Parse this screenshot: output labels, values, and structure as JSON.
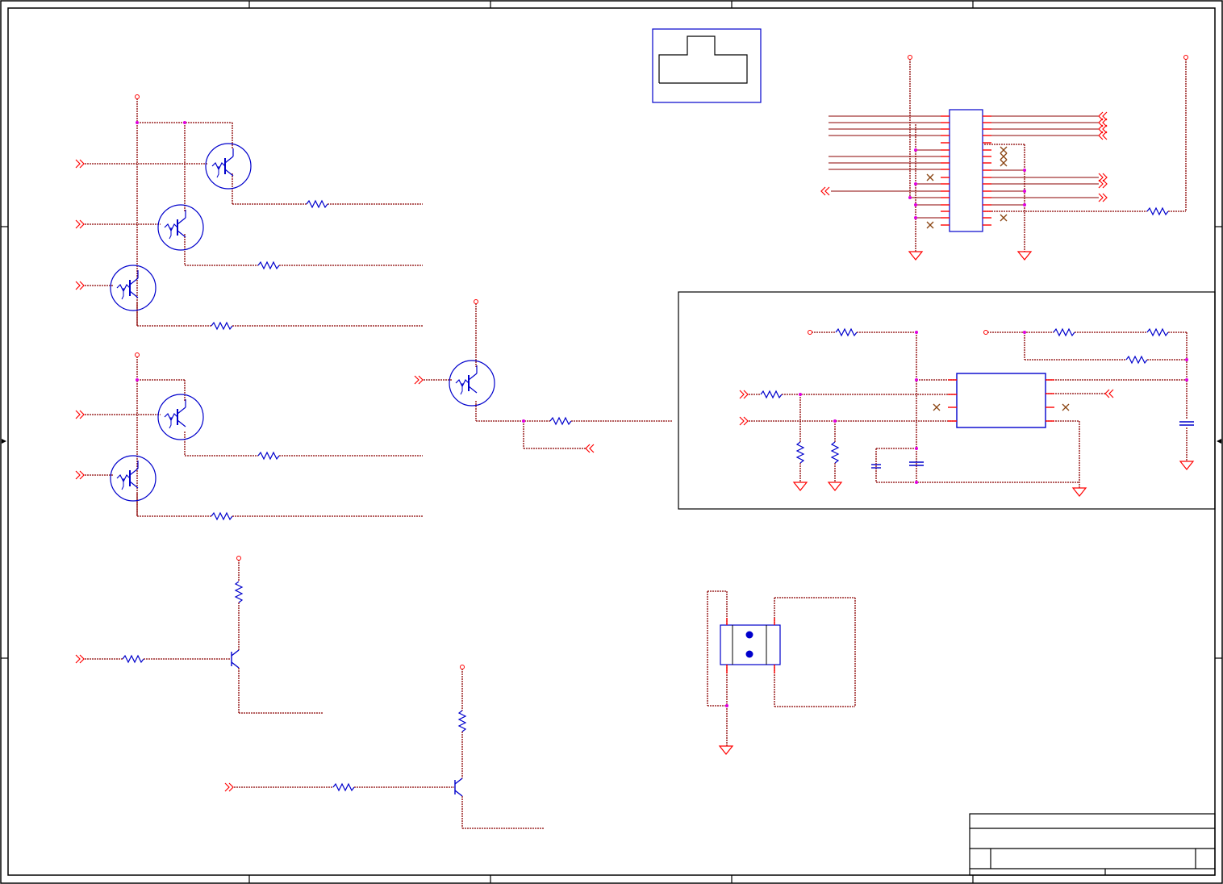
{
  "document": {
    "type": "schematic-sheet",
    "texts": []
  },
  "colors": {
    "wire": "#8b0000",
    "wire_dots": "#d06080",
    "pin": "#ff0000",
    "component": "#0000cc",
    "junction": "#e000e0",
    "no_connect": "#8b4513",
    "border": "#000000"
  },
  "title_block": {
    "title": "",
    "sheet": ""
  }
}
